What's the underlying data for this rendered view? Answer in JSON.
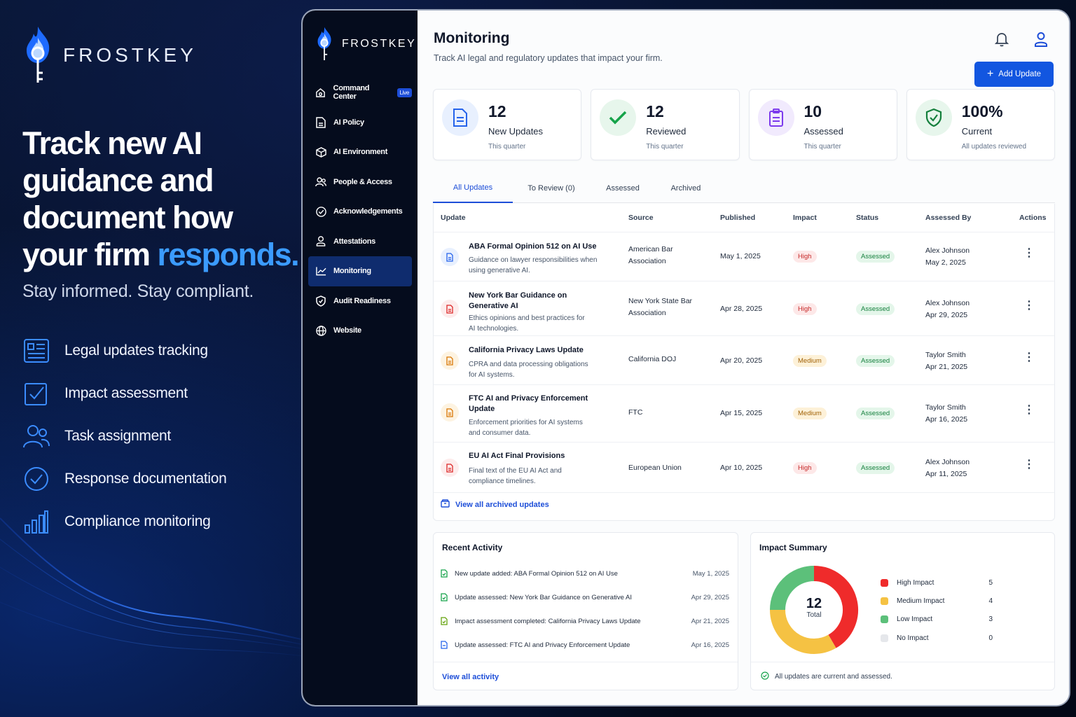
{
  "hero": {
    "brand": "FROSTKEY",
    "headline_part1": "Track new AI guidance and document how your firm ",
    "headline_highlight": "responds.",
    "tagline": "Stay informed. Stay compliant.",
    "features": [
      {
        "icon": "news-list-icon",
        "label": "Legal updates tracking"
      },
      {
        "icon": "checkbox-icon",
        "label": "Impact assessment"
      },
      {
        "icon": "users-icon",
        "label": "Task assignment"
      },
      {
        "icon": "check-circle-icon",
        "label": "Response documentation"
      },
      {
        "icon": "bar-chart-icon",
        "label": "Compliance monitoring"
      }
    ]
  },
  "sidebar": {
    "brand": "FROSTKEY",
    "items": [
      {
        "label": "Command Center",
        "badge": "Live",
        "icon": "home-icon"
      },
      {
        "label": "AI Policy",
        "icon": "document-icon"
      },
      {
        "label": "AI Environment",
        "icon": "cube-icon"
      },
      {
        "label": "People & Access",
        "icon": "people-icon"
      },
      {
        "label": "Acknowledgements",
        "icon": "check-circle-icon"
      },
      {
        "label": "Attestations",
        "icon": "person-icon"
      },
      {
        "label": "Monitoring",
        "icon": "chart-line-icon",
        "active": true
      },
      {
        "label": "Audit Readiness",
        "icon": "shield-check-icon"
      },
      {
        "label": "Website",
        "icon": "globe-icon"
      }
    ]
  },
  "header": {
    "title": "Monitoring",
    "subtitle": "Track AI legal and regulatory updates that impact your firm.",
    "add_button": "Add Update"
  },
  "stats": [
    {
      "value": "12",
      "label": "New Updates",
      "sub": "This quarter",
      "icon": "document-icon",
      "color": "#2563eb",
      "bg": "#e8f0fe"
    },
    {
      "value": "12",
      "label": "Reviewed",
      "sub": "This quarter",
      "icon": "check-icon",
      "color": "#16a34a",
      "bg": "#e7f6ec"
    },
    {
      "value": "10",
      "label": "Assessed",
      "sub": "This quarter",
      "icon": "clipboard-icon",
      "color": "#7c3aed",
      "bg": "#f1eafd"
    },
    {
      "value": "100%",
      "label": "Current",
      "sub": "All updates reviewed",
      "icon": "shield-check-icon",
      "color": "#15803d",
      "bg": "#e7f6ec"
    }
  ],
  "tabs": [
    "All Updates",
    "To Review (0)",
    "Assessed",
    "Archived"
  ],
  "table": {
    "columns": [
      "Update",
      "Source",
      "Published",
      "Impact",
      "Status",
      "Assessed By",
      "Actions"
    ],
    "rows": [
      {
        "title": "ABA Formal Opinion 512 on AI Use",
        "desc": "Guidance on lawyer responsibilities when using generative AI.",
        "source": "American Bar Association",
        "published": "May 1, 2025",
        "impact": "High",
        "status": "Assessed",
        "assessor": "Alex Johnson",
        "assessed_date": "May 2, 2025",
        "icon_color": "#2563eb",
        "icon_bg": "#e8f0fe"
      },
      {
        "title": "New York Bar Guidance on Generative AI",
        "desc": "Ethics opinions and best practices for AI technologies.",
        "source": "New York State Bar Association",
        "published": "Apr 28, 2025",
        "impact": "High",
        "status": "Assessed",
        "assessor": "Alex Johnson",
        "assessed_date": "Apr 29, 2025",
        "icon_color": "#dc2626",
        "icon_bg": "#fdecec"
      },
      {
        "title": "California Privacy Laws Update",
        "desc": "CPRA and data processing obligations for AI systems.",
        "source": "California DOJ",
        "published": "Apr 20, 2025",
        "impact": "Medium",
        "status": "Assessed",
        "assessor": "Taylor Smith",
        "assessed_date": "Apr 21, 2025",
        "icon_color": "#d97706",
        "icon_bg": "#fdf3e1"
      },
      {
        "title": "FTC AI and Privacy Enforcement Update",
        "desc": "Enforcement priorities for AI systems and consumer data.",
        "source": "FTC",
        "published": "Apr 15, 2025",
        "impact": "Medium",
        "status": "Assessed",
        "assessor": "Taylor Smith",
        "assessed_date": "Apr 16, 2025",
        "icon_color": "#d97706",
        "icon_bg": "#fdf3e1"
      },
      {
        "title": "EU AI Act Final Provisions",
        "desc": "Final text of the EU AI Act and compliance timelines.",
        "source": "European Union",
        "published": "Apr 10, 2025",
        "impact": "High",
        "status": "Assessed",
        "assessor": "Alex Johnson",
        "assessed_date": "Apr 11, 2025",
        "icon_color": "#dc2626",
        "icon_bg": "#fdecec"
      }
    ],
    "view_archived": "View all archived updates"
  },
  "activity": {
    "title": "Recent Activity",
    "items": [
      {
        "text": "New update added: ABA Formal Opinion 512 on AI Use",
        "date": "May 1, 2025",
        "color": "#16a34a"
      },
      {
        "text": "Update assessed: New York Bar Guidance on Generative AI",
        "date": "Apr 29, 2025",
        "color": "#16a34a"
      },
      {
        "text": "Impact assessment completed: California Privacy Laws Update",
        "date": "Apr 21, 2025",
        "color": "#65a30d"
      },
      {
        "text": "Update assessed: FTC AI and Privacy Enforcement Update",
        "date": "Apr 16, 2025",
        "color": "#2563eb"
      }
    ],
    "view_all": "View all activity"
  },
  "impact_summary": {
    "title": "Impact Summary",
    "total": "12",
    "total_label": "Total",
    "legend": [
      {
        "label": "High Impact",
        "value": 5,
        "color": "#ef2b2b"
      },
      {
        "label": "Medium Impact",
        "value": 4,
        "color": "#f5c243"
      },
      {
        "label": "Low Impact",
        "value": 3,
        "color": "#5cc07a"
      },
      {
        "label": "No Impact",
        "value": 0,
        "color": "#e5e7eb"
      }
    ],
    "footer": "All updates are current and assessed."
  }
}
